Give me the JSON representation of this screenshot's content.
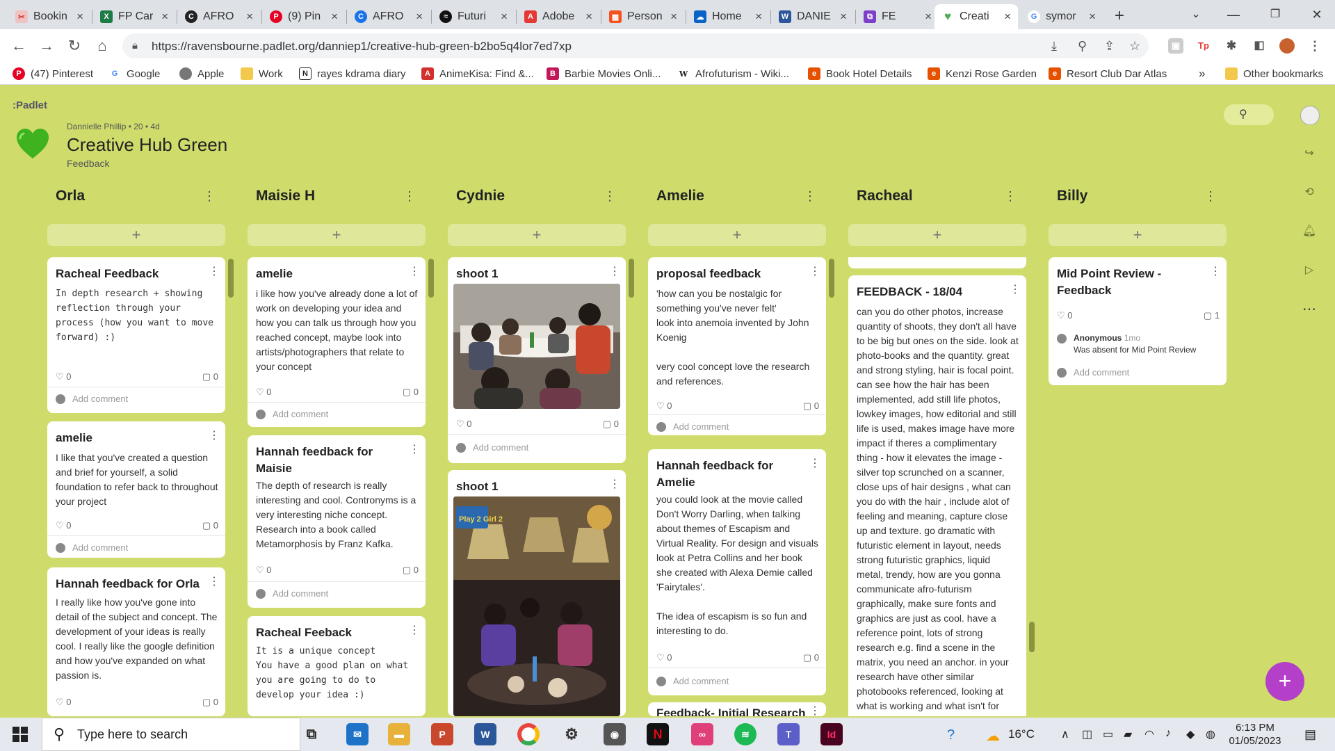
{
  "browser": {
    "tabs": [
      {
        "title": "Bookin",
        "color": "#f0c2c2",
        "glyph": "✂"
      },
      {
        "title": "FP Car",
        "color": "#1d7b45",
        "glyph": "X"
      },
      {
        "title": "AFRO",
        "color": "#222222",
        "glyph": "C"
      },
      {
        "title": "(9) Pin",
        "color": "#e60023",
        "glyph": "P"
      },
      {
        "title": "AFRO",
        "color": "#1a73e8",
        "glyph": "C"
      },
      {
        "title": "Futuri",
        "color": "#111111",
        "glyph": "≈"
      },
      {
        "title": "Adobe",
        "color": "#e53935",
        "glyph": "A"
      },
      {
        "title": "Person",
        "color": "#f4511e",
        "glyph": "▦"
      },
      {
        "title": "Home",
        "color": "#0a64c8",
        "glyph": "☁"
      },
      {
        "title": "DANIE",
        "color": "#2b579a",
        "glyph": "W"
      },
      {
        "title": "FE",
        "color": "#7b3fc9",
        "glyph": "⧉"
      },
      {
        "title": "Creati",
        "color": "#4caf50",
        "glyph": "♥"
      },
      {
        "title": "symor",
        "color": "#4285f4",
        "glyph": "G"
      }
    ],
    "active_tab": "Creati",
    "url": "https://ravensbourne.padlet.org/danniep1/creative-hub-green-b2bo5q4lor7ed7xp",
    "bookmarks": [
      {
        "label": "(47) Pinterest",
        "color": "#e60023",
        "glyph": "P"
      },
      {
        "label": "Google",
        "color": "#4285f4",
        "glyph": "G"
      },
      {
        "label": "Apple",
        "color": "#555555",
        "glyph": ""
      },
      {
        "label": "Work",
        "color": "#f2c94c",
        "glyph": ""
      },
      {
        "label": "rayes kdrama diary",
        "color": "#222222",
        "glyph": "N"
      },
      {
        "label": "AnimeKisa: Find &...",
        "color": "#d32f2f",
        "glyph": "A"
      },
      {
        "label": "Barbie Movies Onli...",
        "color": "#c2185b",
        "glyph": "B"
      },
      {
        "label": "Afrofuturism - Wiki...",
        "color": "#444444",
        "glyph": "W"
      },
      {
        "label": "Book Hotel Details",
        "color": "#e65100",
        "glyph": "e"
      },
      {
        "label": "Kenzi Rose Garden",
        "color": "#e65100",
        "glyph": "e"
      },
      {
        "label": "Resort Club Dar Atlas",
        "color": "#e65100",
        "glyph": "e"
      }
    ],
    "more_bookmarks": "»",
    "other_bookmarks": "Other bookmarks"
  },
  "padlet": {
    "logo": ":Padlet",
    "author": "Dannielle Phillip • 20 • 4d",
    "title": "Creative Hub Green",
    "subtitle": "Feedback",
    "accent_color": "#cfdc6c",
    "fab_label": "+"
  },
  "columns": [
    {
      "name": "Orla"
    },
    {
      "name": "Maisie H"
    },
    {
      "name": "Cydnie"
    },
    {
      "name": "Amelie"
    },
    {
      "name": "Racheal"
    },
    {
      "name": "Billy"
    }
  ],
  "add_label": "+",
  "add_comment_label": "Add comment",
  "cards": {
    "orla_1": {
      "title": "Racheal Feedback",
      "body": "In depth research + showing reflection through your process (how you want to move forward) :)",
      "likes": "0",
      "comments": "0"
    },
    "orla_2": {
      "title": "amelie",
      "body": "I like that you've created a question and brief for yourself, a solid foundation to refer back to throughout your project",
      "likes": "0",
      "comments": "0"
    },
    "orla_3": {
      "title": "Hannah feedback for Orla",
      "body": "I really like how you've gone into detail of the subject and concept. The development of your ideas is really cool. I really like the google definition and how you've expanded on what passion is.",
      "likes": "0",
      "comments": "0"
    },
    "maisie_1": {
      "title": "amelie",
      "body": "i like how you've already done a lot of work on developing your idea and how you can talk us through how you reached concept, maybe look into artists/photographers that relate to your concept",
      "likes": "0",
      "comments": "0"
    },
    "maisie_2": {
      "title": "Hannah feedback for Maisie",
      "body": "The depth of research is really interesting and cool. Contronyms is a very interesting niche concept. Research into a book called Metamorphosis by Franz Kafka.",
      "likes": "0",
      "comments": "0"
    },
    "maisie_3": {
      "title": "Racheal Feeback",
      "body": "It is a unique concept\nYou have a good plan on what you are going to do to develop your idea :)"
    },
    "cydnie_1": {
      "title": "shoot 1",
      "likes": "0",
      "comments": "0"
    },
    "cydnie_2": {
      "title": "shoot 1",
      "image_text": "Play 2 Girl 2"
    },
    "amelie_1": {
      "title": "proposal feedback",
      "body": "'how can you be nostalgic for something you've never felt'\nlook into anemoia invented by John Koenig\n\nvery cool concept love the research and references.",
      "likes": "0",
      "comments": "0"
    },
    "amelie_2": {
      "title": "Hannah feedback for Amelie",
      "body": "you could look at the movie called Don't Worry Darling, when talking about themes of Escapism and Virtual Reality.  For design and visuals look at Petra Collins and her book she created with Alexa Demie called 'Fairytales'.\n\nThe idea of escapism is so fun and interesting to do.",
      "likes": "0",
      "comments": "0"
    },
    "amelie_3": {
      "title": "Feedback- Initial Research"
    },
    "racheal_1": {
      "title": "FEEDBACK - 18/04",
      "body": "can you do other photos, increase quantity of shoots, they don't all have to be big but ones on the side. look at photo-books and the quantity. great and strong styling, hair is focal point. can see how the hair has been implemented, add still life photos, lowkey images, how editorial and still life is used, makes image have more impact if theres a complimentary thing - how it elevates the image - silver top scrunched on a scanner, close ups of hair designs , what can you do with the hair , include alot of feeling and meaning, capture close up and texture. go dramatic with futuristic element in layout, needs strong futuristic graphics, liquid metal, trendy, how are you gonna communicate afro-futurism graphically, make sure fonts and graphics are just as cool. have a reference point, lots of strong research e.g. find a scene in the matrix, you need an anchor. in your research have other similar photobooks referenced, looking at what is working and what isn't for"
    },
    "billy_1": {
      "title": "Mid Point Review - Feedback",
      "likes": "0",
      "comments": "1",
      "comment_author": "Anonymous",
      "comment_time": "1mo",
      "comment_text": "Was absent for Mid Point Review"
    }
  },
  "taskbar": {
    "search_placeholder": "Type here to search",
    "temperature": "16°C",
    "time": "6:13 PM",
    "date": "01/05/2023"
  }
}
